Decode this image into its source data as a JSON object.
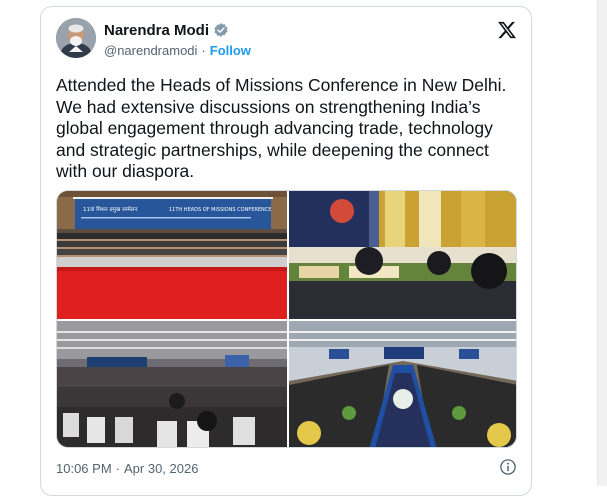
{
  "author": {
    "display_name": "Narendra Modi",
    "handle": "@narendramodi",
    "separator": "·",
    "follow_label": "Follow",
    "verified_icon": "verified-badge-icon",
    "verified_color": "#829aab"
  },
  "platform_icon": "x-logo-icon",
  "tweet": {
    "lines": [
      "Attended the Heads of Missions Conference in New Delhi.",
      "We had extensive discussions on strengthening India’s",
      "global engagement through advancing trade, technology",
      "and strategic partnerships, while deepening the connect",
      "with our diaspora."
    ]
  },
  "media": {
    "banner_texts": [
      "11वां मिशन प्रमुख सम्मेलन",
      "11TH HEADS OF MISSIONS CONFERENCE"
    ]
  },
  "meta": {
    "time": "10:06 PM",
    "separator": "·",
    "date": "Apr 30, 2026",
    "info_icon": "info-icon"
  },
  "colors": {
    "accent": "#1d9bf0",
    "text": "#0f1419",
    "secondary": "#536471"
  }
}
